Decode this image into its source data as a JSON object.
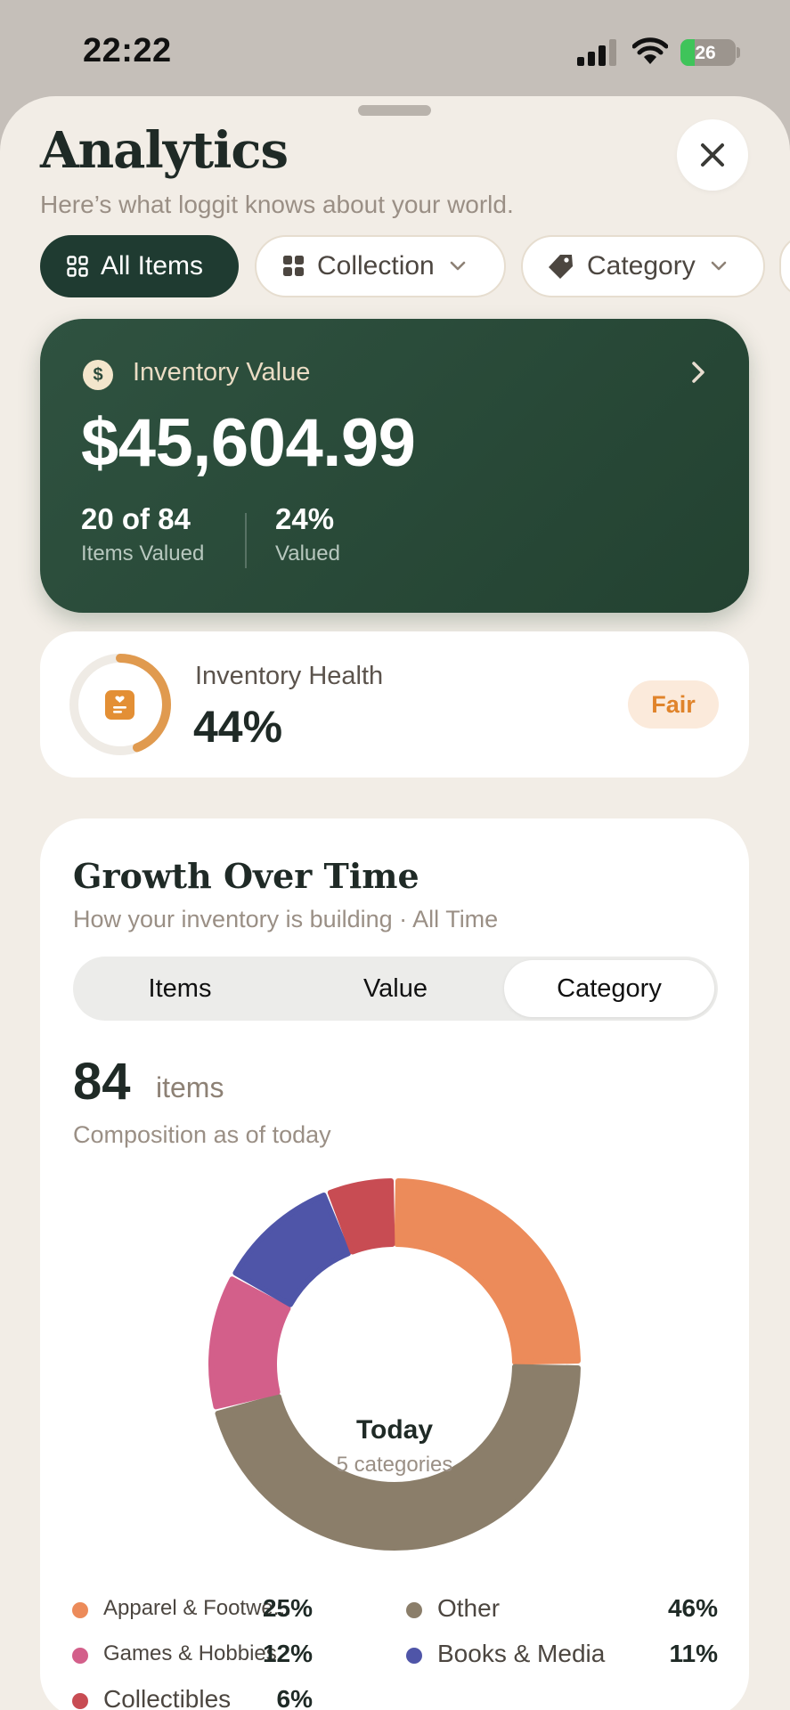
{
  "status_bar": {
    "time": "22:22",
    "battery": "26",
    "battery_level": 0.26
  },
  "header": {
    "title": "Analytics",
    "subtitle": "Here’s what loggit knows about your world."
  },
  "filters": [
    {
      "label": "All Items",
      "icon": "grid-icon",
      "active": true
    },
    {
      "label": "Collection",
      "icon": "collection-icon",
      "active": false
    },
    {
      "label": "Category",
      "icon": "tag-icon",
      "active": false
    }
  ],
  "inventory_value": {
    "icon_glyph": "$",
    "label": "Inventory Value",
    "amount": "$45,604.99",
    "stats": [
      {
        "value": "20 of 84",
        "label": "Items Valued"
      },
      {
        "value": "24%",
        "label": "Valued"
      }
    ]
  },
  "inventory_health": {
    "label": "Inventory Health",
    "value": "44%",
    "fraction": 0.44,
    "badge": "Fair",
    "color": "#e09a4f"
  },
  "growth": {
    "title": "Growth Over Time",
    "subtitle": "How your inventory is building · All Time",
    "tabs": [
      {
        "label": "Items",
        "active": false
      },
      {
        "label": "Value",
        "active": false
      },
      {
        "label": "Category",
        "active": true
      }
    ],
    "count": "84",
    "count_unit": "items",
    "composition_note": "Composition as of today",
    "center_title": "Today",
    "center_subtitle": "5 categories"
  },
  "chart_data": {
    "type": "pie",
    "title": "",
    "categories": [
      "Apparel & Footwe...",
      "Other",
      "Games & Hobbies",
      "Books & Media",
      "Collectibles"
    ],
    "values": [
      25,
      46,
      12,
      11,
      6
    ],
    "value_labels": [
      "25%",
      "46%",
      "12%",
      "11%",
      "6%"
    ],
    "colors": [
      "#ec8b5a",
      "#8b7e6a",
      "#d35f8a",
      "#4f55a8",
      "#c84c53"
    ],
    "legend_placement": "bottom"
  }
}
